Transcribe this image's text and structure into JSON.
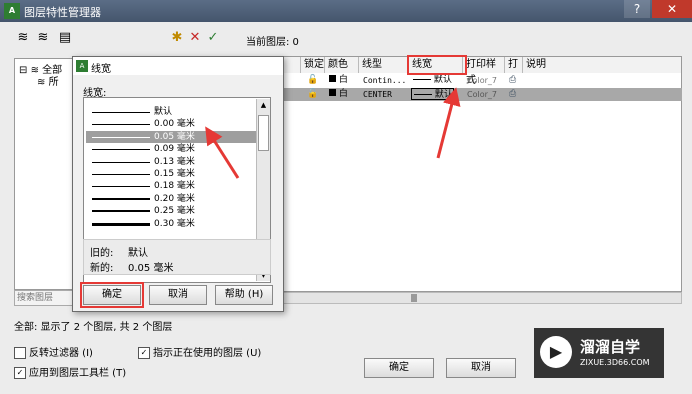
{
  "window": {
    "title": "图层特性管理器"
  },
  "toolbar": {
    "current_layer_label": "当前图层: 0"
  },
  "tree": {
    "root_label": "全部",
    "child_label": "所"
  },
  "search": {
    "placeholder": "搜索图层"
  },
  "table": {
    "columns": [
      "锁定",
      "颜色",
      "线型",
      "线宽",
      "打印样式",
      "打",
      "说明"
    ],
    "rows": [
      {
        "color": "白",
        "linetype": "Contin...",
        "lineweight": "默认",
        "plotstyle": "Color_7"
      },
      {
        "color": "白",
        "linetype": "CENTER",
        "lineweight": "默认",
        "plotstyle": "Color_7"
      }
    ]
  },
  "status": {
    "text": "全部: 显示了 2 个图层, 共 2 个图层"
  },
  "options": {
    "invert_filter": "反转过滤器 (I)",
    "show_in_use": "指示正在使用的图层 (U)",
    "apply_toolbar": "应用到图层工具栏 (T)"
  },
  "buttons": {
    "ok": "确定",
    "cancel": "取消"
  },
  "lw_dialog": {
    "title": "线宽",
    "list_label": "线宽:",
    "items": [
      {
        "label": "默认",
        "weight": 1
      },
      {
        "label": "0.00 毫米",
        "weight": 1
      },
      {
        "label": "0.05 毫米",
        "weight": 1
      },
      {
        "label": "0.09 毫米",
        "weight": 1
      },
      {
        "label": "0.13 毫米",
        "weight": 1
      },
      {
        "label": "0.15 毫米",
        "weight": 1
      },
      {
        "label": "0.18 毫米",
        "weight": 1
      },
      {
        "label": "0.20 毫米",
        "weight": 2
      },
      {
        "label": "0.25 毫米",
        "weight": 2
      },
      {
        "label": "0.30 毫米",
        "weight": 3
      }
    ],
    "selected_index": 2,
    "old_label": "旧的:",
    "old_value": "默认",
    "new_label": "新的:",
    "new_value": "0.05 毫米",
    "ok": "确定",
    "cancel": "取消",
    "help": "帮助 (H)"
  },
  "watermark": {
    "main": "溜溜自学",
    "sub": "ZIXUE.3D66.COM"
  },
  "colors": {
    "accent_red": "#e53935",
    "selection_gray": "#9e9e9e",
    "title_bar": "#4f5f78"
  }
}
